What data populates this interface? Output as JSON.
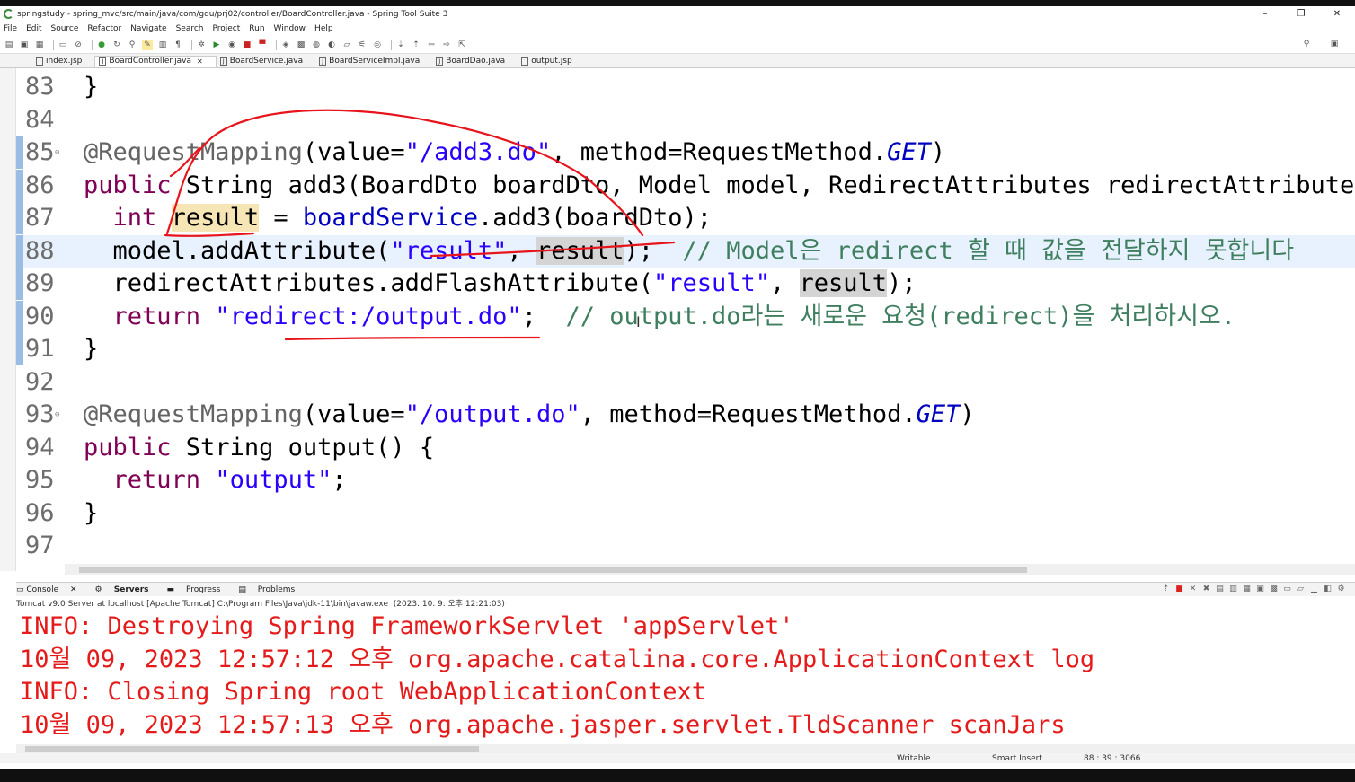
{
  "window": {
    "title": "springstudy - spring_mvc/src/main/java/com/gdu/prj02/controller/BoardController.java - Spring Tool Suite 3",
    "controls": [
      "–",
      "❐",
      "✕"
    ]
  },
  "menu": [
    "File",
    "Edit",
    "Source",
    "Refactor",
    "Navigate",
    "Search",
    "Project",
    "Run",
    "Window",
    "Help"
  ],
  "tabs": [
    {
      "label": "index.jsp",
      "active": false
    },
    {
      "label": "BoardController.java",
      "active": true
    },
    {
      "label": "BoardService.java",
      "active": false
    },
    {
      "label": "BoardServiceImpl.java",
      "active": false
    },
    {
      "label": "BoardDao.java",
      "active": false
    },
    {
      "label": "output.jsp",
      "active": false
    }
  ],
  "editor": {
    "lines": [
      {
        "n": "83",
        "tokens": [
          {
            "t": "}",
            "c": ""
          }
        ]
      },
      {
        "n": "84",
        "tokens": []
      },
      {
        "n": "85",
        "fold": true,
        "marker": true,
        "tokens": [
          {
            "t": "@RequestMapping",
            "c": "ann"
          },
          {
            "t": "(value=",
            "c": ""
          },
          {
            "t": "\"/add3.do\"",
            "c": "str"
          },
          {
            "t": ", method=RequestMethod.",
            "c": ""
          },
          {
            "t": "GET",
            "c": "const"
          },
          {
            "t": ")",
            "c": ""
          }
        ]
      },
      {
        "n": "86",
        "marker": true,
        "tokens": [
          {
            "t": "public",
            "c": "kw"
          },
          {
            "t": " String add3(BoardDto ",
            "c": ""
          },
          {
            "t": "boardDto",
            "c": "param"
          },
          {
            "t": ", Model ",
            "c": ""
          },
          {
            "t": "model",
            "c": "param"
          },
          {
            "t": ", RedirectAttributes ",
            "c": ""
          },
          {
            "t": "redirectAttributes",
            "c": "param"
          },
          {
            "t": ")",
            "c": ""
          }
        ]
      },
      {
        "n": "87",
        "marker": true,
        "tokens": [
          {
            "t": "  ",
            "c": ""
          },
          {
            "t": "int",
            "c": "kw"
          },
          {
            "t": " ",
            "c": ""
          },
          {
            "t": "result",
            "c": "occw"
          },
          {
            "t": " = ",
            "c": ""
          },
          {
            "t": "boardService",
            "c": "fld"
          },
          {
            "t": ".add3(boardDto);",
            "c": ""
          }
        ]
      },
      {
        "n": "88",
        "marker": true,
        "current": true,
        "tokens": [
          {
            "t": "  model.addAttribute(",
            "c": ""
          },
          {
            "t": "\"result\"",
            "c": "str"
          },
          {
            "t": ", ",
            "c": ""
          },
          {
            "t": "result",
            "c": "occ"
          },
          {
            "t": ");  ",
            "c": ""
          },
          {
            "t": "// Model은 redirect 할 때 값을 전달하지 못합니다",
            "c": "cmt"
          }
        ]
      },
      {
        "n": "89",
        "marker": true,
        "tokens": [
          {
            "t": "  redirectAttributes.addFlashAttribute(",
            "c": ""
          },
          {
            "t": "\"result\"",
            "c": "str"
          },
          {
            "t": ", ",
            "c": ""
          },
          {
            "t": "result",
            "c": "occ"
          },
          {
            "t": ");",
            "c": ""
          }
        ]
      },
      {
        "n": "90",
        "marker": true,
        "tokens": [
          {
            "t": "  ",
            "c": ""
          },
          {
            "t": "return",
            "c": "kw"
          },
          {
            "t": " ",
            "c": ""
          },
          {
            "t": "\"redirect:/output.do\"",
            "c": "str"
          },
          {
            "t": ";  ",
            "c": ""
          },
          {
            "t": "// output.do라는 새로운 요청(redirect)을 처리하시오.",
            "c": "cmt"
          }
        ]
      },
      {
        "n": "91",
        "marker": true,
        "tokens": [
          {
            "t": "}",
            "c": ""
          }
        ]
      },
      {
        "n": "92",
        "tokens": []
      },
      {
        "n": "93",
        "fold": true,
        "tokens": [
          {
            "t": "@RequestMapping",
            "c": "ann"
          },
          {
            "t": "(value=",
            "c": ""
          },
          {
            "t": "\"/output.do\"",
            "c": "str"
          },
          {
            "t": ", method=RequestMethod.",
            "c": ""
          },
          {
            "t": "GET",
            "c": "const"
          },
          {
            "t": ")",
            "c": ""
          }
        ]
      },
      {
        "n": "94",
        "tokens": [
          {
            "t": "public",
            "c": "kw"
          },
          {
            "t": " String output() {",
            "c": ""
          }
        ]
      },
      {
        "n": "95",
        "tokens": [
          {
            "t": "  ",
            "c": ""
          },
          {
            "t": "return",
            "c": "kw"
          },
          {
            "t": " ",
            "c": ""
          },
          {
            "t": "\"output\"",
            "c": "str"
          },
          {
            "t": ";",
            "c": ""
          }
        ]
      },
      {
        "n": "96",
        "tokens": [
          {
            "t": "}",
            "c": ""
          }
        ]
      },
      {
        "n": "97",
        "tokens": []
      }
    ]
  },
  "panel": {
    "tabs": [
      {
        "label": "Console",
        "bold": false,
        "closable": true
      },
      {
        "label": "Servers",
        "bold": true,
        "closable": false
      },
      {
        "label": "Progress",
        "bold": false,
        "closable": false
      },
      {
        "label": "Problems",
        "bold": false,
        "closable": false
      }
    ],
    "description": "Tomcat v9.0 Server at localhost [Apache Tomcat] C:\\Program Files\\Java\\jdk-11\\bin\\javaw.exe  (2023. 10. 9. 오후 12:21:03)",
    "console_lines": [
      "INFO: Destroying Spring FrameworkServlet 'appServlet'",
      "10월 09, 2023 12:57:12 오후 org.apache.catalina.core.ApplicationContext log",
      "INFO: Closing Spring root WebApplicationContext",
      "10월 09, 2023 12:57:13 오후 org.apache.jasper.servlet.TldScanner scanJars"
    ]
  },
  "status": {
    "writable": "Writable",
    "insert_mode": "Smart Insert",
    "position": "88 : 39 : 3066"
  },
  "colors": {
    "keyword": "#7f0055",
    "string": "#2a00ff",
    "comment": "#3f7f5f",
    "console_error": "#e51a1a",
    "ink": "#e8141c"
  },
  "icons": [
    "eclipse-logo-icon",
    "search-icon",
    "perspective-icon",
    "file-icon",
    "close-icon",
    "server-icon",
    "stop-icon"
  ]
}
